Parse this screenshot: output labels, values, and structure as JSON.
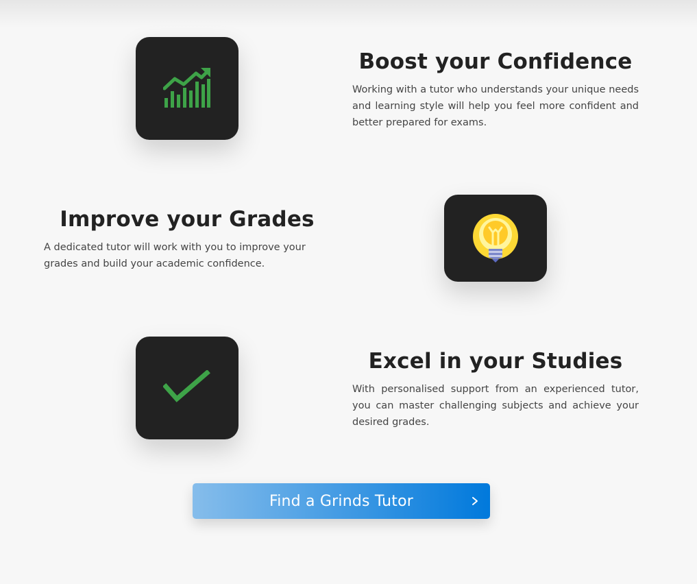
{
  "features": [
    {
      "title": "Boost your Confidence",
      "description": "Working with a tutor who understands your unique needs and learning style will help you feel more confident and better prepared for exams.",
      "icon": "growth-chart-icon"
    },
    {
      "title": "Improve your Grades",
      "description": "A dedicated tutor will work with you to improve your grades and build your academic confidence.",
      "icon": "lightbulb-icon"
    },
    {
      "title": "Excel in your Studies",
      "description": "With personalised support from an experienced tutor, you can master challenging subjects and achieve your desired grades.",
      "icon": "checkmark-icon"
    }
  ],
  "cta": {
    "label": "Find a Grinds Tutor",
    "icon": "chevron-right-icon"
  },
  "colors": {
    "background": "#f7f7f7",
    "icon_box": "#222222",
    "icon_green": "#3ea348",
    "bulb_yellow": "#fdd835",
    "cta_start": "#86bdeb",
    "cta_end": "#0079dc"
  }
}
